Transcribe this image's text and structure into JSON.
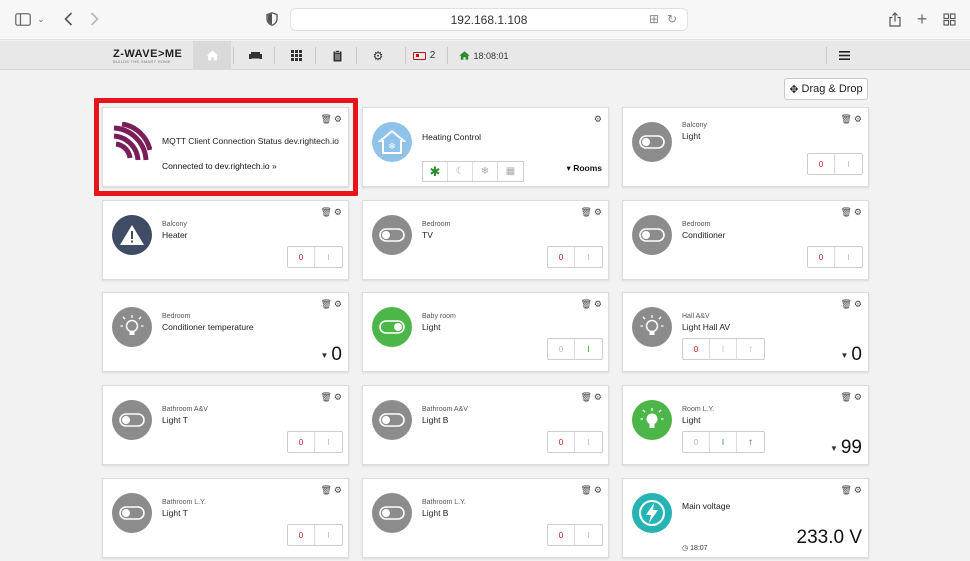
{
  "browser": {
    "url": "192.168.1.108"
  },
  "app": {
    "logo": "Z-WAVE>ME",
    "tagline": "BUILDS THE SMART HOME",
    "battery_count": "2",
    "clock": "18:08:01",
    "drag_drop_label": "Drag & Drop"
  },
  "widgets": {
    "mqtt": {
      "title": "MQTT Client Connection Status dev.rightech.io",
      "status": "Connected to dev.rightech.io »"
    },
    "heating": {
      "name": "Heating Control",
      "rooms_label": "Rooms"
    },
    "balcony_light": {
      "location": "Balcony",
      "name": "Light",
      "off": "0",
      "on": "I"
    },
    "balcony_heater": {
      "location": "Balcony",
      "name": "Heater",
      "off": "0",
      "on": "I"
    },
    "bedroom_tv": {
      "location": "Bedroom",
      "name": "TV",
      "off": "0",
      "on": "I"
    },
    "bedroom_conditioner": {
      "location": "Bedroom",
      "name": "Conditioner",
      "off": "0",
      "on": "I"
    },
    "bedroom_cond_temp": {
      "location": "Bedroom",
      "name": "Conditioner temperature",
      "value": "0"
    },
    "baby_light": {
      "location": "Baby room",
      "name": "Light",
      "off": "0",
      "on": "I"
    },
    "hall_light": {
      "location": "Hall A&V",
      "name": "Light Hall AV",
      "off": "0",
      "on": "I",
      "value": "0"
    },
    "bath_av_light_t": {
      "location": "Bathroom A&V",
      "name": "Light T",
      "off": "0",
      "on": "I"
    },
    "bath_av_light_b": {
      "location": "Bathroom A&V",
      "name": "Light B",
      "off": "0",
      "on": "I"
    },
    "room_ly_light": {
      "location": "Room L.Y.",
      "name": "Light",
      "off": "0",
      "on": "I",
      "value": "99"
    },
    "bath_ly_light_t": {
      "location": "Bathroom L.Y.",
      "name": "Light T",
      "off": "0",
      "on": "I"
    },
    "bath_ly_light_b": {
      "location": "Bathroom L.Y.",
      "name": "Light B",
      "off": "0",
      "on": "I"
    },
    "main_voltage": {
      "name": "Main voltage",
      "value": "233.0 V",
      "time": "18:07"
    }
  },
  "colors": {
    "highlight": "#e8141c",
    "off_red": "#c0141c",
    "on_green": "#2e8b2e",
    "icon_grey": "#8c8c8c",
    "icon_green": "#4cb648",
    "mqtt_purple": "#7a1e5a",
    "heating_blue": "#8fc3ea",
    "warning_navy": "#3f4c63",
    "voltage_teal": "#25b3b3"
  },
  "icons": [
    "sidebar-icon",
    "back-icon",
    "forward-icon",
    "shield-icon",
    "translate-icon",
    "reload-icon",
    "share-icon",
    "plus-icon",
    "tabs-icon",
    "home-icon",
    "sofa-icon",
    "grid-icon",
    "clipboard-icon",
    "gears-icon",
    "battery-icon",
    "house-icon",
    "menu-icon",
    "trash-icon",
    "gear-icon",
    "toggle-icon",
    "bulb-icon",
    "warning-icon",
    "lightning-icon",
    "clock-icon"
  ]
}
